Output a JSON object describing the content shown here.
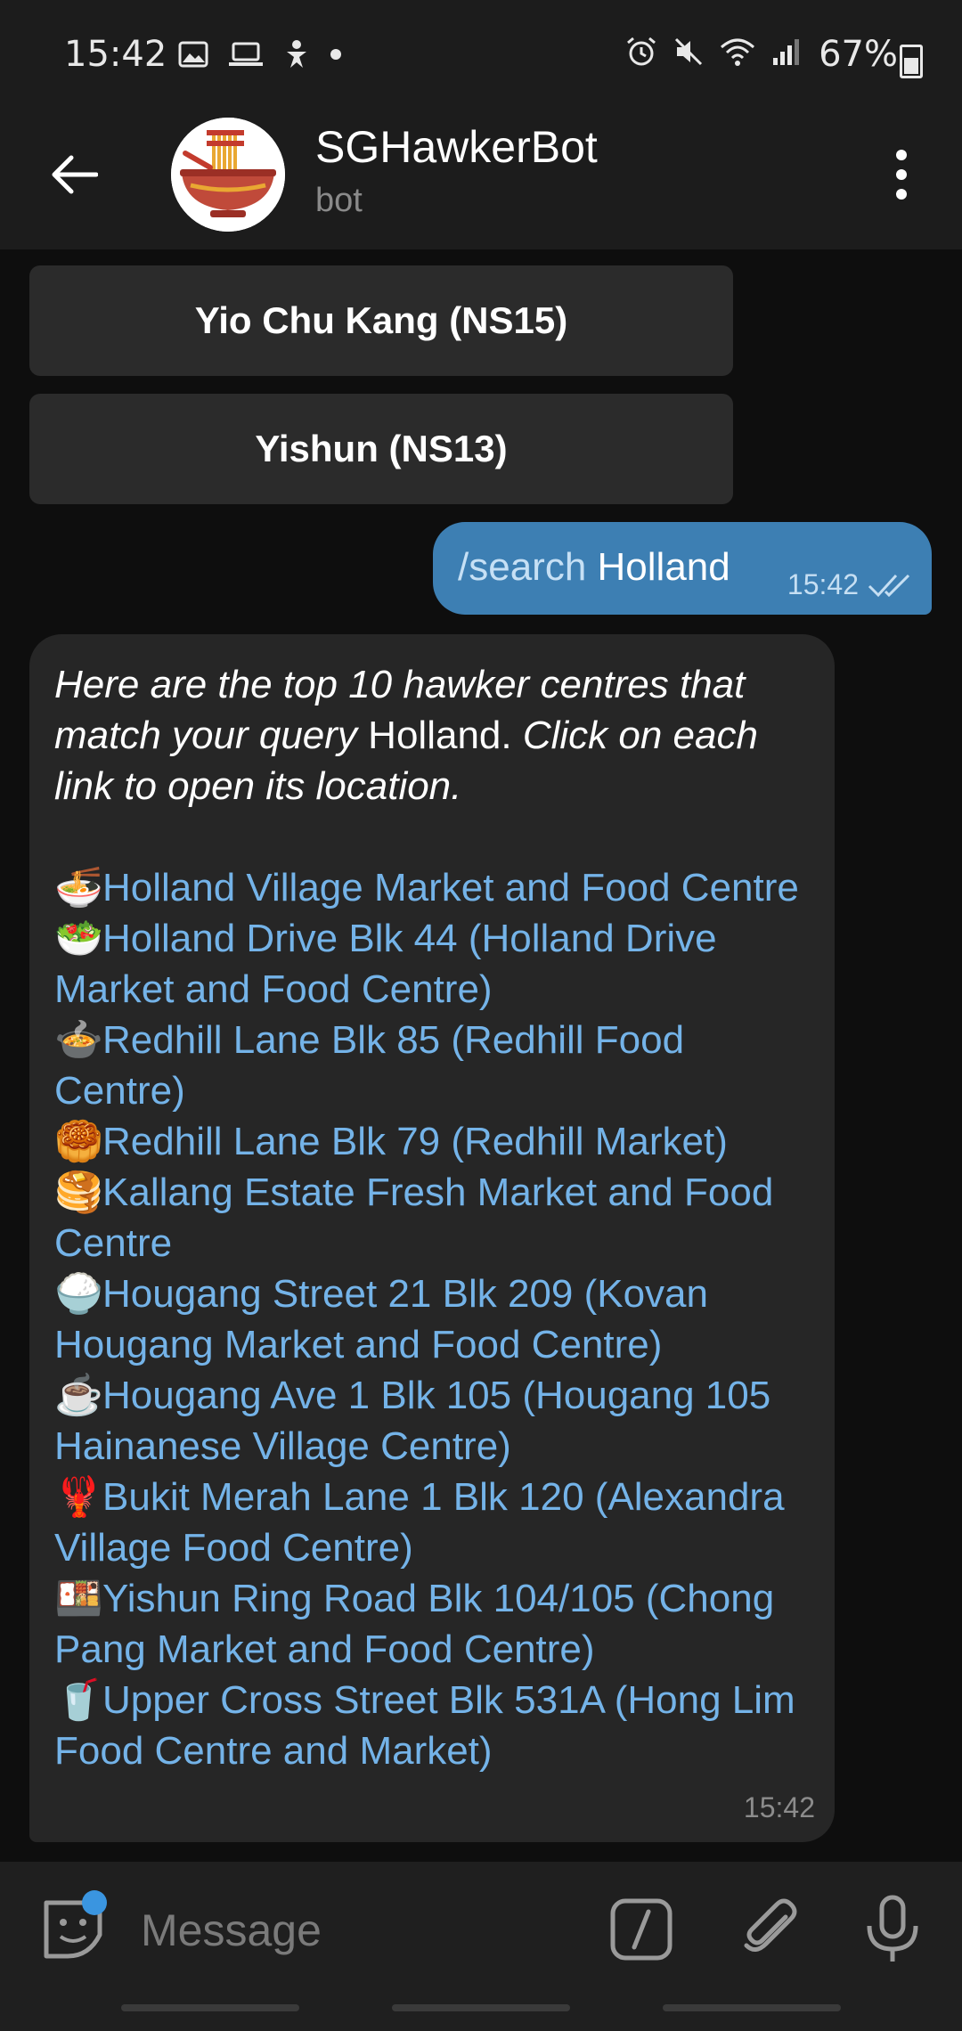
{
  "status_bar": {
    "time": "15:42",
    "battery": "67%",
    "left_icons": [
      "image-icon",
      "laptop-icon",
      "accessibility-icon",
      "dot-icon"
    ],
    "right_icons": [
      "alarm-icon",
      "mute-icon",
      "wifi-icon",
      "signal-icon",
      "battery-icon"
    ]
  },
  "header": {
    "title": "SGHawkerBot",
    "subtitle": "bot"
  },
  "keyboard_buttons": [
    {
      "label": "Yio Chu Kang (NS15)"
    },
    {
      "label": "Yishun (NS13)"
    }
  ],
  "outgoing": {
    "command": "/search",
    "argument": "Holland",
    "time": "15:42"
  },
  "incoming": {
    "intro_italic_1": "Here are the top 10 hawker centres that match your query",
    "intro_query": "Holland.",
    "intro_italic_2": "Click on each link to open its location.",
    "links": [
      {
        "emoji": "🍜",
        "text": "Holland Village Market and Food Centre"
      },
      {
        "emoji": "🥗",
        "text": "Holland Drive Blk 44 (Holland Drive Market and Food Centre)"
      },
      {
        "emoji": "🍲",
        "text": "Redhill Lane Blk 85 (Redhill Food Centre)"
      },
      {
        "emoji": "🥮",
        "text": "Redhill Lane Blk 79 (Redhill Market)"
      },
      {
        "emoji": "🥞",
        "text": "Kallang Estate Fresh Market and Food Centre"
      },
      {
        "emoji": "🍚",
        "text": "Hougang Street 21 Blk 209 (Kovan Hougang Market and Food Centre)"
      },
      {
        "emoji": "☕",
        "text": "Hougang Ave 1 Blk 105 (Hougang 105 Hainanese Village Centre)"
      },
      {
        "emoji": "🦞",
        "text": "Bukit Merah Lane 1 Blk 120 (Alexandra Village Food Centre)"
      },
      {
        "emoji": "🍱",
        "text": "Yishun Ring Road Blk 104/105 (Chong Pang Market and Food Centre)"
      },
      {
        "emoji": "🥤",
        "text": "Upper Cross Street Blk 531A (Hong Lim Food Centre and Market)"
      }
    ],
    "time": "15:42"
  },
  "composer": {
    "placeholder": "Message"
  },
  "colors": {
    "accent_blue": "#3d7fb3",
    "link_blue": "#74b3e8",
    "header_bg": "#1c1c1c",
    "chat_bg": "#0e0e0e"
  }
}
